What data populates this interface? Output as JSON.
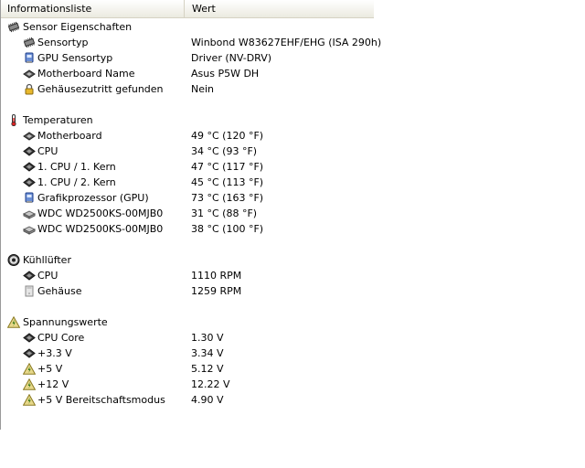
{
  "columns": {
    "name": "Informationsliste",
    "value": "Wert"
  },
  "groups": [
    {
      "title": "Sensor Eigenschaften",
      "icon": "chip-icon",
      "items": [
        {
          "label": "Sensortyp",
          "value": "Winbond W83627EHF/EHG  (ISA 290h)",
          "icon": "chip-icon"
        },
        {
          "label": "GPU Sensortyp",
          "value": "Driver  (NV-DRV)",
          "icon": "gpu-icon"
        },
        {
          "label": "Motherboard Name",
          "value": "Asus P5W DH",
          "icon": "motherboard-icon"
        },
        {
          "label": "Gehäusezutritt gefunden",
          "value": "Nein",
          "icon": "lock-icon"
        }
      ]
    },
    {
      "title": "Temperaturen",
      "icon": "thermometer-icon",
      "items": [
        {
          "label": "Motherboard",
          "value": "49 °C  (120 °F)",
          "icon": "motherboard-icon"
        },
        {
          "label": "CPU",
          "value": "34 °C  (93 °F)",
          "icon": "cpu-icon"
        },
        {
          "label": "1. CPU / 1. Kern",
          "value": "47 °C  (117 °F)",
          "icon": "cpu-icon"
        },
        {
          "label": "1. CPU / 2. Kern",
          "value": "45 °C  (113 °F)",
          "icon": "cpu-icon"
        },
        {
          "label": "Grafikprozessor (GPU)",
          "value": "73 °C  (163 °F)",
          "icon": "gpu-icon"
        },
        {
          "label": "WDC WD2500KS-00MJB0",
          "value": "31 °C  (88 °F)",
          "icon": "hard-drive-icon"
        },
        {
          "label": "WDC WD2500KS-00MJB0",
          "value": "38 °C  (100 °F)",
          "icon": "hard-drive-icon"
        }
      ]
    },
    {
      "title": "Kühllüfter",
      "icon": "fan-icon",
      "items": [
        {
          "label": "CPU",
          "value": "1110 RPM",
          "icon": "cpu-icon"
        },
        {
          "label": "Gehäuse",
          "value": "1259 RPM",
          "icon": "case-icon"
        }
      ]
    },
    {
      "title": "Spannungswerte",
      "icon": "voltage-icon",
      "items": [
        {
          "label": "CPU Core",
          "value": "1.30 V",
          "icon": "cpu-icon"
        },
        {
          "label": "+3.3 V",
          "value": "3.34 V",
          "icon": "cpu-icon"
        },
        {
          "label": "+5 V",
          "value": "5.12 V",
          "icon": "voltage-icon"
        },
        {
          "label": "+12 V",
          "value": "12.22 V",
          "icon": "voltage-icon"
        },
        {
          "label": "+5 V Bereitschaftsmodus",
          "value": "4.90 V",
          "icon": "voltage-icon"
        }
      ]
    }
  ]
}
